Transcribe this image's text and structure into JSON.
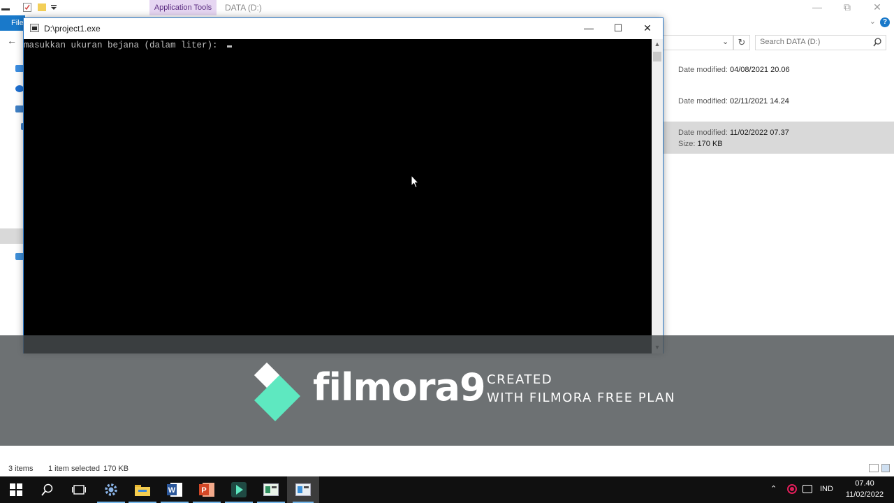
{
  "explorer": {
    "ribbon_context_tab": "Application Tools",
    "title": "DATA (D:)",
    "file_tab_label": "File",
    "search_placeholder": "Search DATA (D:)",
    "files": [
      {
        "date_label": "Date modified:",
        "date_value": "04/08/2021 20.06"
      },
      {
        "date_label": "Date modified:",
        "date_value": "02/11/2021 14.24"
      },
      {
        "date_label": "Date modified:",
        "date_value": "11/02/2022 07.37",
        "size_label": "Size:",
        "size_value": "170 KB",
        "selected": true
      }
    ],
    "status": {
      "item_count": "3 items",
      "selected": "1 item selected",
      "selected_size": "170 KB"
    }
  },
  "console": {
    "title": "D:\\project1.exe",
    "output_line": "masukkan ukuran bejana (dalam liter): "
  },
  "watermark": {
    "brand": "filmora9",
    "line1": "CREATED",
    "line2": "WITH FILMORA FREE PLAN",
    "logo_colors": {
      "top": "#ffffff",
      "bottom": "#5ee8c0"
    }
  },
  "taskbar": {
    "apps": [
      "start-icon",
      "search-icon",
      "task-view-icon",
      "settings-gear-icon",
      "file-explorer-icon",
      "word-icon",
      "powerpoint-icon",
      "filmora-icon",
      "window-app-icon",
      "console-app-icon"
    ],
    "tray": {
      "language": "IND",
      "time": "07.40",
      "date": "11/02/2022"
    }
  },
  "colors": {
    "accent": "#1979ca",
    "console_bg": "#000000",
    "console_fg": "#c0c0c0",
    "context_tab_bg": "#e6d6f2",
    "record_red": "#e01e5a"
  }
}
